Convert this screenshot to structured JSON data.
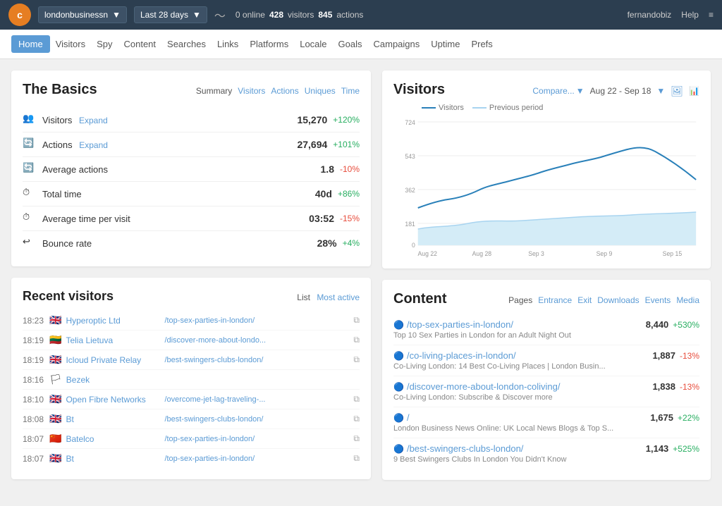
{
  "topnav": {
    "logo_text": "c",
    "site": "londonbusinessn",
    "date_range": "Last 28 days",
    "online": "0 online",
    "visitors_label": "visitors",
    "visitors_count": "428",
    "actions_label": "actions",
    "actions_count": "845",
    "user": "fernandobiz",
    "help": "Help"
  },
  "subnav": {
    "items": [
      "Home",
      "Visitors",
      "Spy",
      "Content",
      "Searches",
      "Links",
      "Platforms",
      "Locale",
      "Goals",
      "Campaigns",
      "Uptime",
      "Prefs"
    ]
  },
  "basics": {
    "title": "The Basics",
    "tabs": {
      "summary": "Summary",
      "visitors": "Visitors",
      "actions": "Actions",
      "uniques": "Uniques",
      "time": "Time"
    },
    "rows": [
      {
        "icon": "👥",
        "label": "Visitors",
        "expandable": true,
        "value": "15,270",
        "change": "+120%",
        "positive": true
      },
      {
        "icon": "🔄",
        "label": "Actions",
        "expandable": true,
        "value": "27,694",
        "change": "+101%",
        "positive": true
      },
      {
        "icon": "🔄",
        "label": "Average actions",
        "expandable": false,
        "value": "1.8",
        "change": "-10%",
        "positive": false
      },
      {
        "icon": "⏱",
        "label": "Total time",
        "expandable": false,
        "value": "40d",
        "change": "+86%",
        "positive": true
      },
      {
        "icon": "⏱",
        "label": "Average time per visit",
        "expandable": false,
        "value": "03:52",
        "change": "-15%",
        "positive": false
      },
      {
        "icon": "↩",
        "label": "Bounce rate",
        "expandable": false,
        "value": "28%",
        "change": "+4%",
        "positive": true
      }
    ]
  },
  "recent_visitors": {
    "title": "Recent visitors",
    "list_label": "List",
    "most_active_label": "Most active",
    "rows": [
      {
        "time": "18:23",
        "flag": "🇬🇧",
        "name": "Hyperoptic Ltd",
        "path": "/top-sex-parties-in-london/"
      },
      {
        "time": "18:19",
        "flag": "🇱🇹",
        "name": "Telia Lietuva",
        "path": "/discover-more-about-londo..."
      },
      {
        "time": "18:19",
        "flag": "🇬🇧",
        "name": "Icloud Private Relay",
        "path": "/best-swingers-clubs-london/"
      },
      {
        "time": "18:16",
        "flag": "🏳",
        "name": "Bezek",
        "path": ""
      },
      {
        "time": "18:10",
        "flag": "🇬🇧",
        "name": "Open Fibre Networks",
        "path": "/overcome-jet-lag-traveling-..."
      },
      {
        "time": "18:08",
        "flag": "🇬🇧",
        "name": "Bt",
        "path": "/best-swingers-clubs-london/"
      },
      {
        "time": "18:07",
        "flag": "🇨🇳",
        "name": "Batelco",
        "path": "/top-sex-parties-in-london/"
      },
      {
        "time": "18:07",
        "flag": "🇬🇧",
        "name": "Bt",
        "path": "/top-sex-parties-in-london/"
      }
    ]
  },
  "visitors_chart": {
    "title": "Visitors",
    "compare_label": "Compare...",
    "date_range": "Aug 22 - Sep 18",
    "legend_visitors": "Visitors",
    "legend_previous": "Previous period",
    "y_labels": [
      "724",
      "543",
      "362",
      "181",
      "0"
    ],
    "x_labels": [
      "Aug 22",
      "Aug 28",
      "Sep 3",
      "Sep 9",
      "Sep 15"
    ]
  },
  "content": {
    "title": "Content",
    "tabs": {
      "pages": "Pages",
      "entrance": "Entrance",
      "exit": "Exit",
      "downloads": "Downloads",
      "events": "Events",
      "media": "Media"
    },
    "rows": [
      {
        "url": "/top-sex-parties-in-london/",
        "count": "8,440",
        "change": "+530%",
        "positive": true,
        "desc": "Top 10 Sex Parties in London for an Adult Night Out"
      },
      {
        "url": "/co-living-places-in-london/",
        "count": "1,887",
        "change": "-13%",
        "positive": false,
        "desc": "Co-Living London: 14 Best Co-Living Places | London Busin..."
      },
      {
        "url": "/discover-more-about-london-coliving/",
        "count": "1,838",
        "change": "-13%",
        "positive": false,
        "desc": "Co-Living London: Subscribe & Discover more"
      },
      {
        "url": "/",
        "count": "1,675",
        "change": "+22%",
        "positive": true,
        "desc": "London Business News Online: UK Local News Blogs & Top S..."
      },
      {
        "url": "/best-swingers-clubs-london/",
        "count": "1,143",
        "change": "+525%",
        "positive": true,
        "desc": "9 Best Swingers Clubs In London You Didn't Know"
      }
    ]
  }
}
